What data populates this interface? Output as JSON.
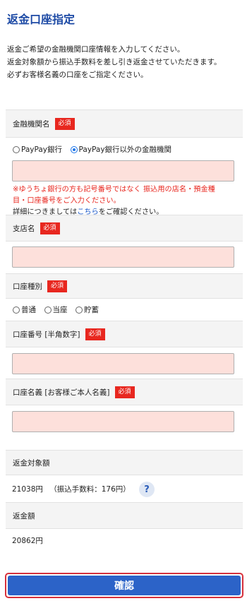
{
  "page": {
    "title": "返金口座指定",
    "intro": [
      "返金ご希望の金融機関口座情報を入力してください。",
      "返金対象額から振込手数料を差し引き返金させていただきます。",
      "必ずお客様名義の口座をご指定ください。"
    ]
  },
  "required_badge": "必須",
  "bank": {
    "label": "金融機関名",
    "options": [
      "PayPay銀行",
      "PayPay銀行以外の金融機関"
    ],
    "selected_index": 1,
    "note_red_1": "※ゆうちょ銀行の方も記号番号ではなく 振込用の店名・預金種",
    "note_red_2": "目・口座番号をご入力ください。",
    "note_prefix": "詳細につきましては",
    "note_link": "こちら",
    "note_suffix": "をご確認ください。"
  },
  "branch": {
    "label": "支店名"
  },
  "account_type": {
    "label": "口座種別",
    "options": [
      "普通",
      "当座",
      "貯蓄"
    ]
  },
  "account_number": {
    "label": "口座番号 [半角数字]"
  },
  "account_holder": {
    "label": "口座名義 [お客様ご本人名義]"
  },
  "refund_target": {
    "label": "返金対象額",
    "amount": "21038円",
    "fee": "（振込手数料：176円）",
    "help_symbol": "?"
  },
  "refund": {
    "label": "返金額",
    "amount": "20862円"
  },
  "confirm_label": "確認",
  "colors": {
    "accent": "#2c63c8",
    "required": "#e8271f",
    "input_bg": "#fde0db"
  }
}
